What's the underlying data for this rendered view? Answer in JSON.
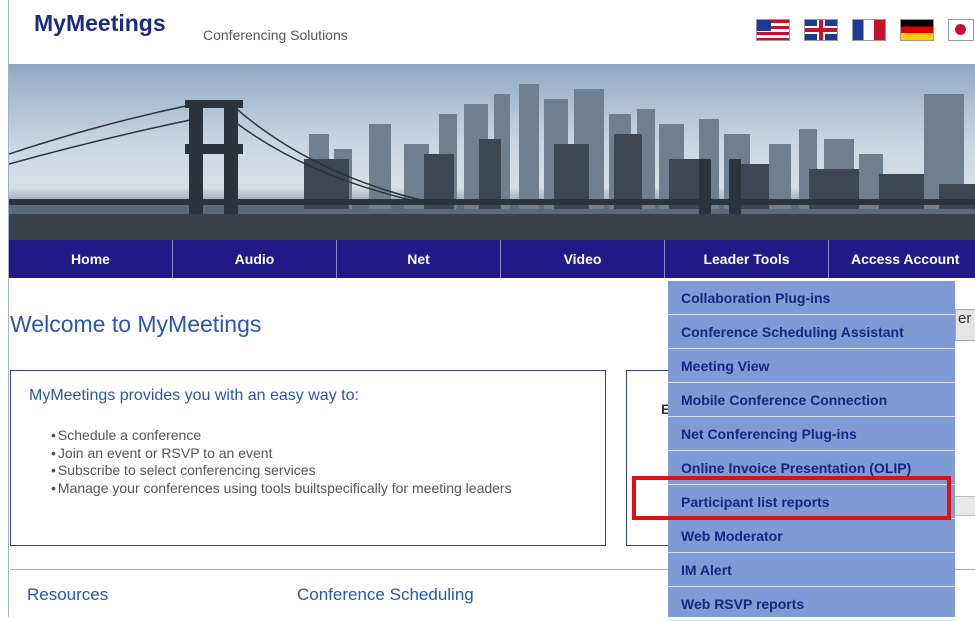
{
  "header": {
    "brand": "MyMeetings",
    "tagline": "Conferencing Solutions",
    "flags": [
      "us-flag-icon",
      "uk-flag-icon",
      "france-flag-icon",
      "germany-flag-icon",
      "japan-flag-icon"
    ]
  },
  "nav": {
    "items": [
      {
        "label": "Home"
      },
      {
        "label": "Audio"
      },
      {
        "label": "Net"
      },
      {
        "label": "Video"
      },
      {
        "label": "Leader Tools"
      },
      {
        "label": "Access Account"
      }
    ]
  },
  "main": {
    "welcome": "Welcome to MyMeetings",
    "intro_heading": "MyMeetings provides you with an easy way to:",
    "bullets": [
      "Schedule a conference",
      "Join an event or RSVP to an event",
      "Subscribe to select conferencing services",
      "Manage your conferences using tools builtspecifically for meeting leaders"
    ],
    "right_box_letter": "E",
    "side_button_fragment": "er",
    "resources": "Resources",
    "conference_scheduling": "Conference Scheduling"
  },
  "dropdown": {
    "items": [
      {
        "label": "Collaboration Plug-ins"
      },
      {
        "label": "Conference Scheduling Assistant"
      },
      {
        "label": "Meeting View"
      },
      {
        "label": "Mobile Conference Connection"
      },
      {
        "label": "Net Conferencing Plug-ins"
      },
      {
        "label": "Online Invoice Presentation (OLIP)"
      },
      {
        "label": "Participant list reports"
      },
      {
        "label": "Web Moderator"
      },
      {
        "label": "IM Alert"
      },
      {
        "label": "Web RSVP reports"
      }
    ]
  },
  "colors": {
    "nav_bg": "#1f1a86",
    "dropdown_bg": "#7f9bd6",
    "highlight": "#e01010",
    "title_blue": "#2a56b0"
  }
}
